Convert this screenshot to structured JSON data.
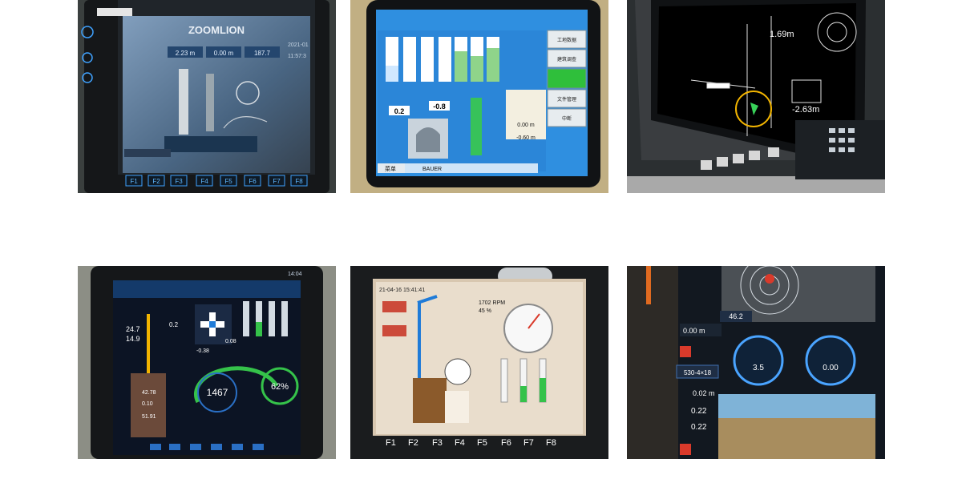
{
  "gallery": {
    "photos": [
      {
        "brand": "ZOOMLION",
        "values": [
          "2.23 m",
          "0.00 m",
          "187.7",
          "2021-01",
          "11:57:3"
        ],
        "fkeys": [
          "F1",
          "F2",
          "F3",
          "F4",
          "F5",
          "F6",
          "F7",
          "F8"
        ]
      },
      {
        "menu": [
          "工地数据",
          "建筑调查",
          "文件管理",
          "中断"
        ],
        "values": [
          "0.2",
          "-0.8",
          "0.00 m",
          "-0.60 m"
        ],
        "footer": "菜单",
        "brand": "BAUER"
      },
      {
        "values": [
          "1.69m",
          "-2.63m"
        ]
      },
      {
        "values": [
          "24.7",
          "14.9",
          "0.2",
          "-0.38",
          "0.08",
          "1467",
          "62%",
          "42.78",
          "0.10",
          "51.91"
        ],
        "time": "14:04"
      },
      {
        "time": "21-04-16 15:41:41",
        "values": [
          "1702 RPM",
          "45 %"
        ],
        "fkeys": [
          "F1",
          "F2",
          "F3",
          "F4",
          "F5",
          "F6",
          "F7",
          "F8"
        ]
      },
      {
        "values": [
          "0.00 m",
          "46.2",
          "530-4×18",
          "0.02 m",
          "0.22",
          "0.22",
          "3.5",
          "0.00"
        ]
      }
    ]
  },
  "colors": {
    "bezel": "#1b1d20",
    "ui_blue": "#1f4f9a",
    "bauer_blue": "#2f8fe0",
    "panel_dark": "#0c1424",
    "accent_green": "#35c24a",
    "accent_yellow": "#f2b400",
    "accent_red": "#d93a2b"
  }
}
